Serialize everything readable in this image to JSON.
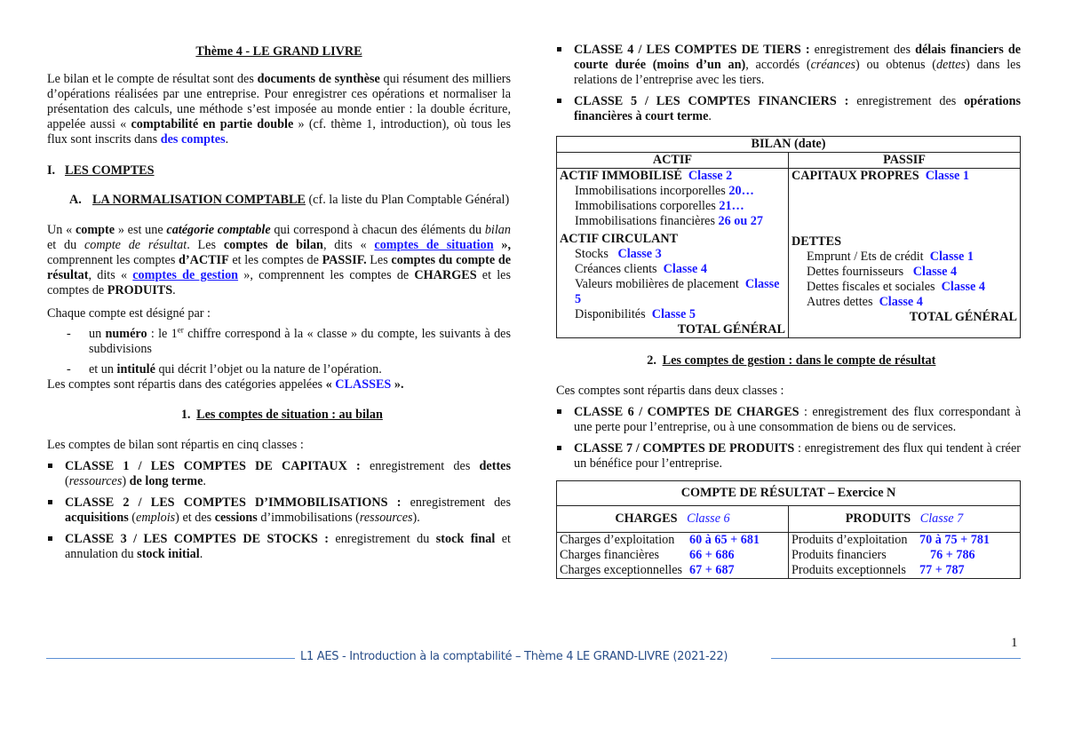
{
  "title": "Thème 4 - LE GRAND LIVRE",
  "intro": {
    "t1": "Le bilan et le compte de résultat sont des ",
    "b1": "documents de synthèse",
    "t2": " qui résument des milliers d’opérations réalisées par une entreprise. Pour enregistrer ces opérations et normaliser la présentation des calculs, une méthode s’est imposée au monde entier : la double écriture, appelée aussi « ",
    "b2": "comptabilité en partie double",
    "t3": " » (cf. thème 1, introduction), où tous les flux sont inscrits dans ",
    "blue": "des comptes",
    "t4": "."
  },
  "section1": {
    "num": "I.",
    "label": "LES COMPTES"
  },
  "sectionA": {
    "num": "A.",
    "label": "LA NORMALISATION COMPTABLE",
    "rest": " (cf. la liste du Plan Comptable Général)"
  },
  "compte_def": {
    "t1": "Un « ",
    "b1": "compte",
    "t2": " » est une ",
    "bi1": "catégorie comptable",
    "t3": " qui correspond à chacun des éléments du ",
    "i1": "bilan",
    "t4": " et du ",
    "i2": "compte de résultat",
    "t5": ". Les ",
    "b2": "comptes de bilan",
    "t6": ", dits « ",
    "link1": "comptes de situation",
    "t7": " »,",
    "t8": " comprennent les comptes ",
    "b3": "d’ACTIF",
    "t9": " et les comptes de ",
    "b4": "PASSIF.",
    "t10": " Les ",
    "b5": "comptes du compte de résultat",
    "t11": ", dits « ",
    "link2": "comptes de gestion",
    "t12": " », comprennent les comptes de ",
    "b6": "CHARGES",
    "t13": " et les comptes de ",
    "b7": "PRODUITS",
    "t14": "."
  },
  "designation": {
    "intro": "Chaque compte est désigné par :",
    "item1": {
      "t1": "un ",
      "b": "numéro",
      "t2": " : le 1",
      "sup": "er",
      "t3": " chiffre correspond à la « classe » du compte, les suivants à des subdivisions"
    },
    "item2": {
      "t1": "et un ",
      "b": "intitulé",
      "t2": " qui décrit l’objet ou la nature de l’opération."
    },
    "classes": {
      "t1": "Les comptes sont répartis dans des catégories appelées ",
      "b1": "« ",
      "blue": "CLASSES",
      "b2": " »."
    }
  },
  "section2_1": {
    "num": "1.",
    "label": "Les comptes de situation : au bilan"
  },
  "bilan_intro": "Les comptes de bilan sont répartis en cinq classes :",
  "classes_bilan": [
    {
      "head": "CLASSE 1 / LES COMPTES DE CAPITAUX :",
      "t1": " enregistrement des ",
      "b1": "dettes",
      "t2": " (",
      "i1": "ressources",
      "t3": ") ",
      "b2": "de long terme",
      "t4": "."
    },
    {
      "head": "CLASSE 2 / LES COMPTES D’IMMOBILISATIONS :",
      "t1": " enregistrement des ",
      "b1": "acquisitions",
      "t2": " (",
      "i1": "emplois",
      "t3": ") et des ",
      "b2": "cessions",
      "t4": " d’immobilisations (",
      "i2": "ressources",
      "t5": ")."
    },
    {
      "head": "CLASSE 3 / LES COMPTES DE STOCKS :",
      "t1": " enregistrement du ",
      "b1": "stock final",
      "t2": " et annulation du ",
      "b2": "stock initial",
      "t3": "."
    },
    {
      "head": "CLASSE 4 / LES COMPTES DE TIERS :",
      "t1": " enregistrement des ",
      "b1": "délais financiers de courte durée (moins d’un an)",
      "t2": ", accordés (",
      "i1": "créances",
      "t3": ") ou obtenus (",
      "i2": "dettes",
      "t4": ") dans les relations de l’entreprise avec les tiers."
    },
    {
      "head": "CLASSE 5 / LES COMPTES FINANCIERS :",
      "t1": " enregistrement des ",
      "b1": "opérations financières à court terme",
      "t2": "."
    }
  ],
  "bilan_table": {
    "title": "BILAN (date)",
    "actif_header": "ACTIF",
    "passif_header": "PASSIF",
    "actif": {
      "group1": {
        "label": "ACTIF IMMOBILISÉ",
        "classe": "Classe 2"
      },
      "items1": [
        {
          "label": "Immobilisations incorporelles ",
          "code": "20…"
        },
        {
          "label": "Immobilisations corporelles ",
          "code": "21…"
        },
        {
          "label": "Immobilisations financières ",
          "code": "26 ou 27"
        }
      ],
      "group2": {
        "label": "ACTIF CIRCULANT"
      },
      "items2": [
        {
          "label": "Stocks ",
          "code": "Classe 3"
        },
        {
          "label": "Créances clients ",
          "code": "Classe 4"
        },
        {
          "label": "Valeurs mobilières de placement ",
          "code": "Classe 5"
        },
        {
          "label": "Disponibilités ",
          "code": "Classe 5"
        }
      ],
      "total": "TOTAL GÉNÉRAL"
    },
    "passif": {
      "group1": {
        "label": "CAPITAUX PROPRES",
        "classe": "Classe 1"
      },
      "group2": {
        "label": "DETTES"
      },
      "items2": [
        {
          "label": "Emprunt / Ets de crédit ",
          "code": "Classe 1"
        },
        {
          "label": "Dettes fournisseurs ",
          "code": "Classe 4"
        },
        {
          "label": "Dettes fiscales et sociales ",
          "code": "Classe 4"
        },
        {
          "label": "Autres dettes ",
          "code": "Classe 4"
        }
      ],
      "total": "TOTAL GÉNÉRAL"
    }
  },
  "section2_2": {
    "num": "2.",
    "label": "Les comptes de gestion : dans le compte de résultat"
  },
  "gestion_intro": "Ces comptes sont répartis dans deux classes :",
  "classes_gestion": [
    {
      "head": "CLASSE 6 / COMPTES DE CHARGES",
      "t1": " : enregistrement des flux correspondant à une perte pour l’entreprise, ou à une consommation de biens ou de services."
    },
    {
      "head": "CLASSE 7 / COMPTES DE PRODUITS",
      "t1": " : enregistrement des flux qui tendent à créer un bénéfice pour l’entreprise."
    }
  ],
  "cr_table": {
    "title": "COMPTE DE RÉSULTAT – Exercice N",
    "charges_header": "CHARGES",
    "charges_classe": "Classe 6",
    "produits_header": "PRODUITS",
    "produits_classe": "Classe 7",
    "charges": [
      {
        "label": "Charges d’exploitation",
        "code": "60 à 65 + 681"
      },
      {
        "label": "Charges financières",
        "code": "66 + 686"
      },
      {
        "label": "Charges exceptionnelles",
        "code": "67 + 687"
      }
    ],
    "produits": [
      {
        "label": "Produits d’exploitation",
        "code": "70 à 75 + 781"
      },
      {
        "label": "Produits financiers",
        "code": "76 + 786"
      },
      {
        "label": "Produits exceptionnels",
        "code": "77 + 787"
      }
    ]
  },
  "footer": {
    "text": "L1 AES - Introduction à la comptabilité – Thème 4 LE GRAND-LIVRE (2021-22)",
    "page": "1"
  }
}
